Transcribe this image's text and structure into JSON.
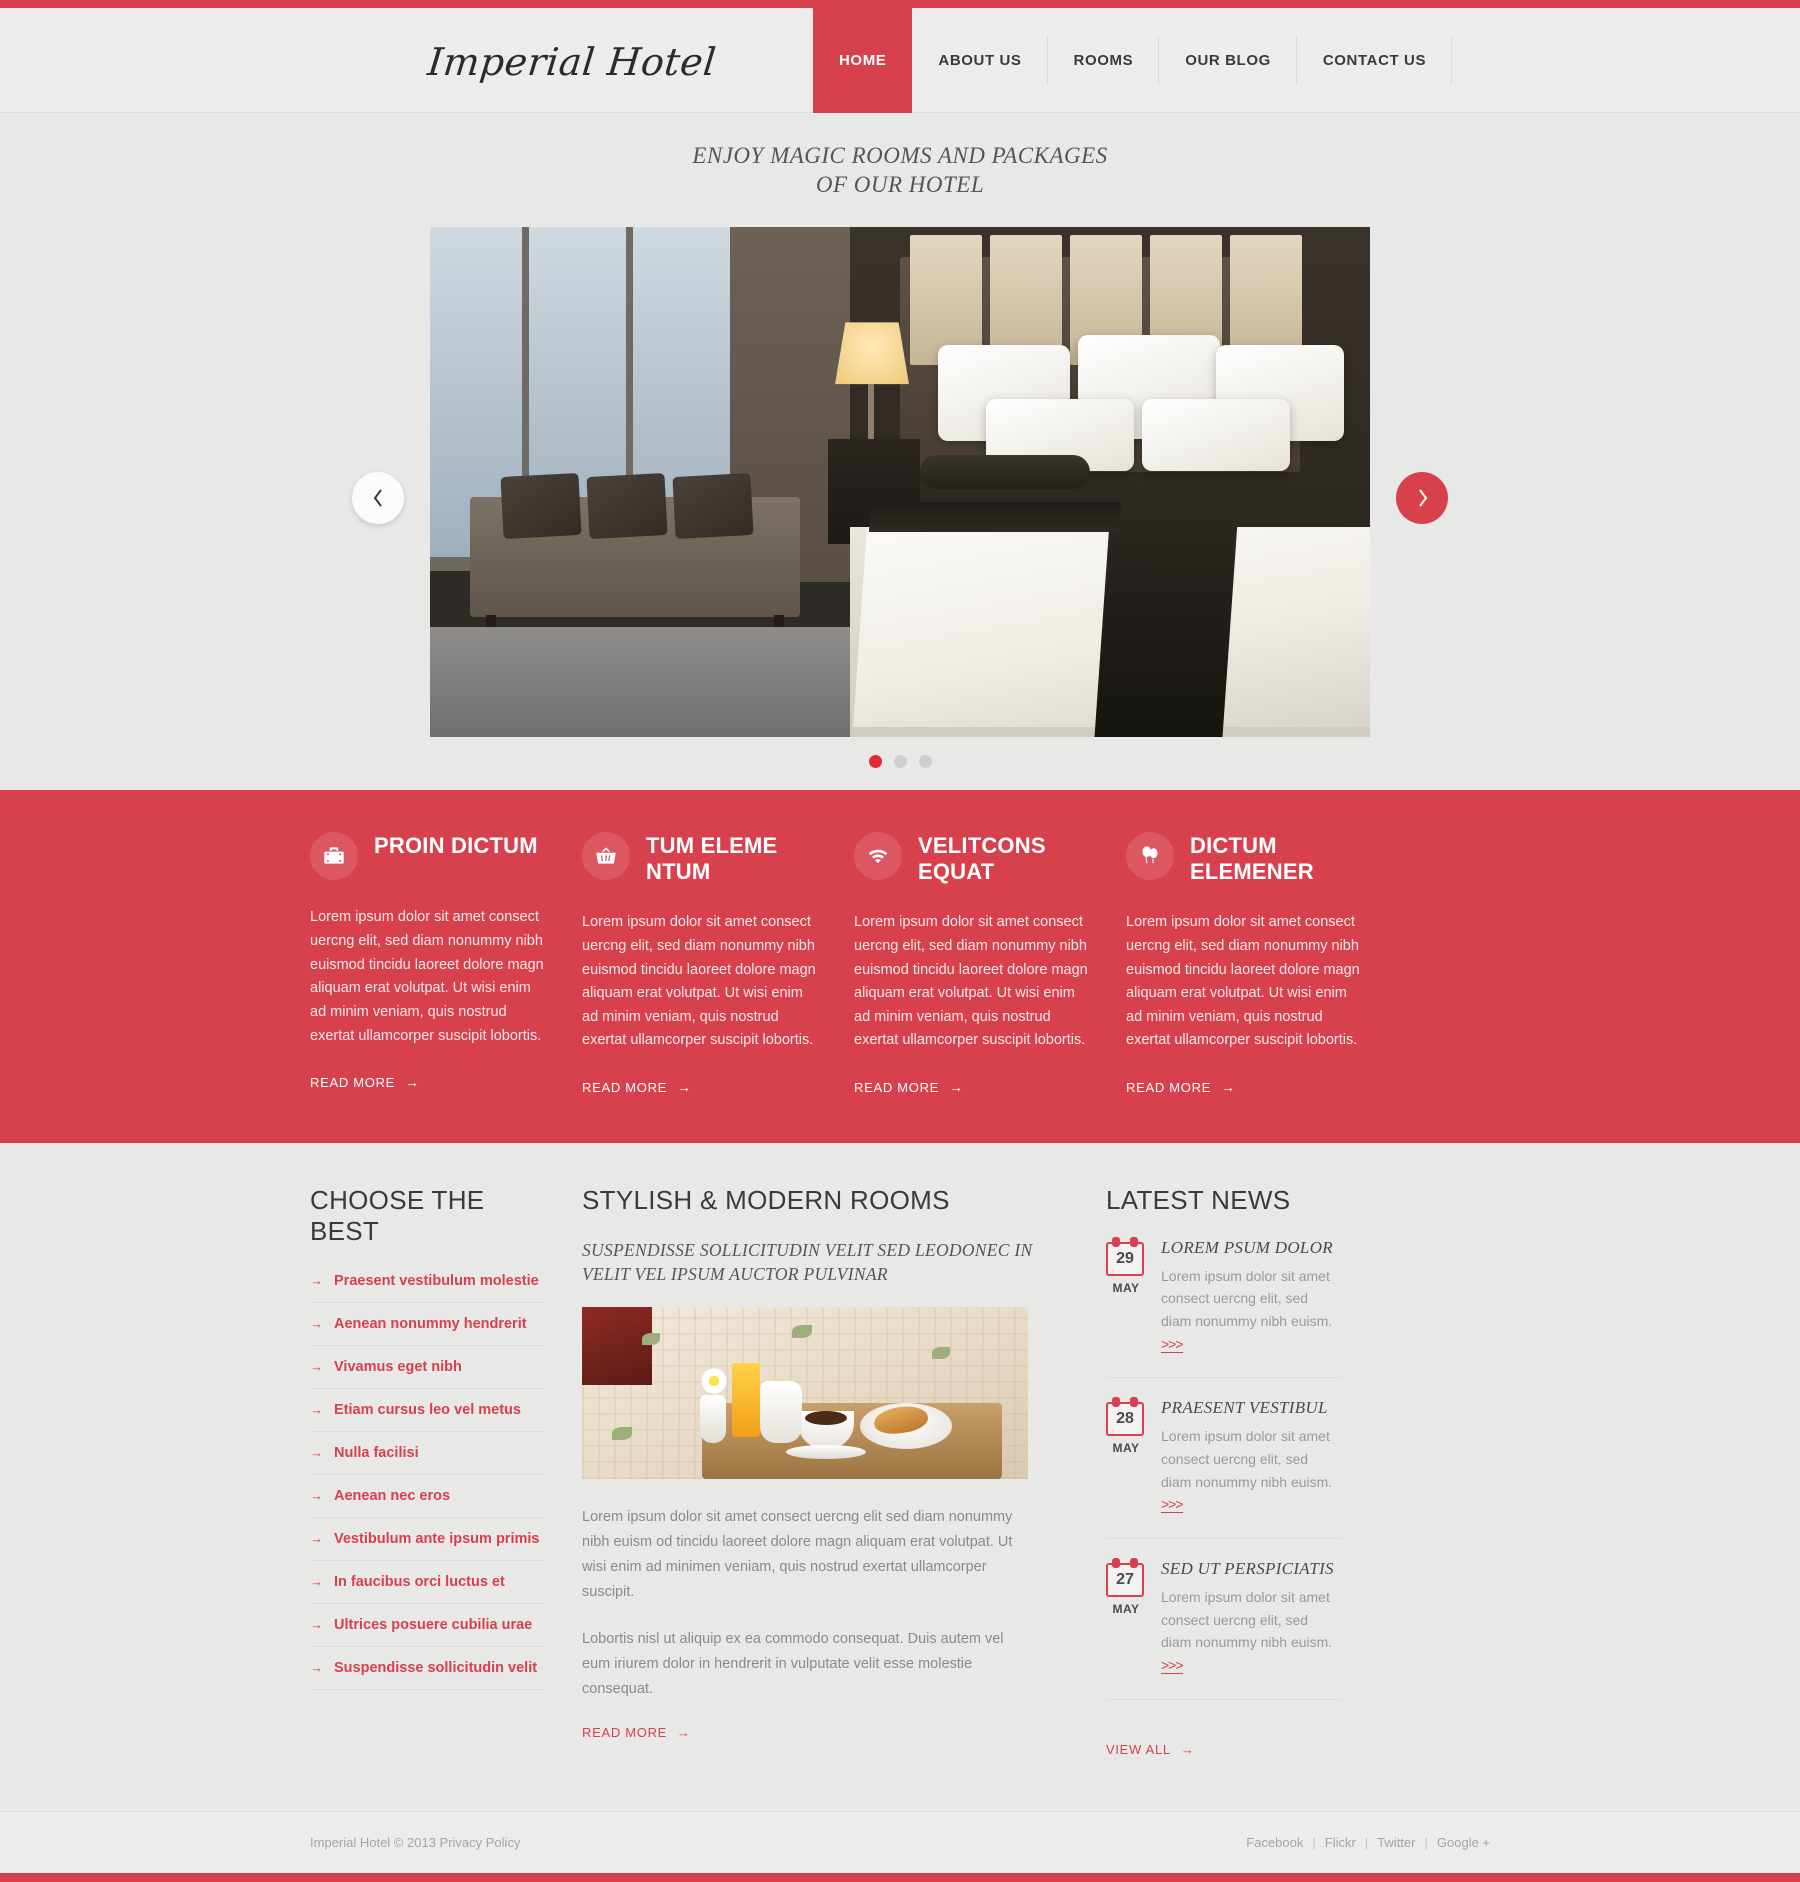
{
  "site": {
    "logo": "Imperial Hotel",
    "accent_color": "#d6414d",
    "bg_color": "#e8e8e6"
  },
  "nav": {
    "items": [
      {
        "label": "HOME",
        "active": true
      },
      {
        "label": "ABOUT US",
        "active": false
      },
      {
        "label": "ROOMS",
        "active": false
      },
      {
        "label": "OUR BLOG",
        "active": false
      },
      {
        "label": "CONTACT US",
        "active": false
      }
    ]
  },
  "tagline": {
    "line1": "ENJOY MAGIC ROOMS AND PACKAGES",
    "line2": "OF OUR HOTEL"
  },
  "slider": {
    "prev_icon": "chevron-left-icon",
    "next_icon": "chevron-right-icon",
    "dots": [
      {
        "active": true
      },
      {
        "active": false
      },
      {
        "active": false
      }
    ]
  },
  "features": [
    {
      "icon": "suitcase-icon",
      "title": "PROIN DICTUM",
      "body": "Lorem ipsum dolor sit amet consect uercng elit, sed diam nonummy nibh euismod tincidu laoreet dolore magn aliquam erat volutpat. Ut wisi enim ad minim veniam, quis nostrud exertat ullamcorper suscipit lobortis.",
      "more": "READ MORE"
    },
    {
      "icon": "basket-icon",
      "title": "TUM ELEME NTUM",
      "body": "Lorem ipsum dolor sit amet consect uercng elit, sed diam nonummy nibh euismod tincidu laoreet dolore magn aliquam erat volutpat. Ut wisi enim ad minim veniam, quis nostrud exertat ullamcorper suscipit lobortis.",
      "more": "READ MORE"
    },
    {
      "icon": "wifi-icon",
      "title": "VELITCONS EQUAT",
      "body": "Lorem ipsum dolor sit amet consect uercng elit, sed diam nonummy nibh euismod tincidu laoreet dolore magn aliquam erat volutpat. Ut wisi enim ad minim veniam, quis nostrud exertat ullamcorper suscipit lobortis.",
      "more": "READ MORE"
    },
    {
      "icon": "balloons-icon",
      "title": "DICTUM ELEMENER",
      "body": "Lorem ipsum dolor sit amet consect uercng elit, sed diam nonummy nibh euismod tincidu laoreet dolore magn aliquam erat volutpat. Ut wisi enim ad minim veniam, quis nostrud exertat ullamcorper suscipit lobortis.",
      "more": "READ MORE"
    }
  ],
  "choose_the_best": {
    "title": "CHOOSE THE BEST",
    "items": [
      "Praesent vestibulum molestie",
      "Aenean nonummy hendrerit",
      "Vivamus eget nibh",
      "Etiam cursus leo vel metus",
      "Nulla facilisi",
      "Aenean nec eros",
      "Vestibulum ante ipsum primis",
      "In faucibus orci luctus et",
      "Ultrices posuere cubilia urae",
      "Suspendisse sollicitudin velit"
    ]
  },
  "rooms": {
    "title": "STYLISH & MODERN ROOMS",
    "subtitle": "SUSPENDISSE SOLLICITUDIN VELIT SED LEODONEC IN VELIT VEL IPSUM AUCTOR PULVINAR",
    "paragraph1": "Lorem ipsum dolor sit amet consect uercng elit sed diam nonummy nibh euism od tincidu laoreet dolore magn aliquam erat volutpat. Ut wisi enim ad minimen veniam, quis nostrud exertat ullamcorper suscipit.",
    "paragraph2": "Lobortis nisl ut aliquip ex ea commodo consequat. Duis autem vel eum iriurem dolor in hendrerit in vulputate velit esse molestie consequat.",
    "more": "READ MORE"
  },
  "latest_news": {
    "title": "LATEST NEWS",
    "items": [
      {
        "day": "29",
        "month": "MAY",
        "title": "LOREM PSUM DOLOR",
        "text": "Lorem ipsum dolor sit amet consect uercng elit, sed diam nonummy nibh euism.",
        "more": ">>>"
      },
      {
        "day": "28",
        "month": "MAY",
        "title": "PRAESENT VESTIBUL",
        "text": "Lorem ipsum dolor sit amet consect uercng elit, sed diam nonummy nibh euism.",
        "more": ">>>"
      },
      {
        "day": "27",
        "month": "MAY",
        "title": "SED UT PERSPICIATIS",
        "text": "Lorem ipsum dolor sit amet consect uercng elit, sed diam nonummy nibh euism.",
        "more": ">>>"
      }
    ],
    "view_all": "VIEW ALL"
  },
  "footer": {
    "copyright": "Imperial Hotel © 2013 Privacy Policy",
    "links": [
      "Facebook",
      "Flickr",
      "Twitter",
      "Google +"
    ]
  }
}
